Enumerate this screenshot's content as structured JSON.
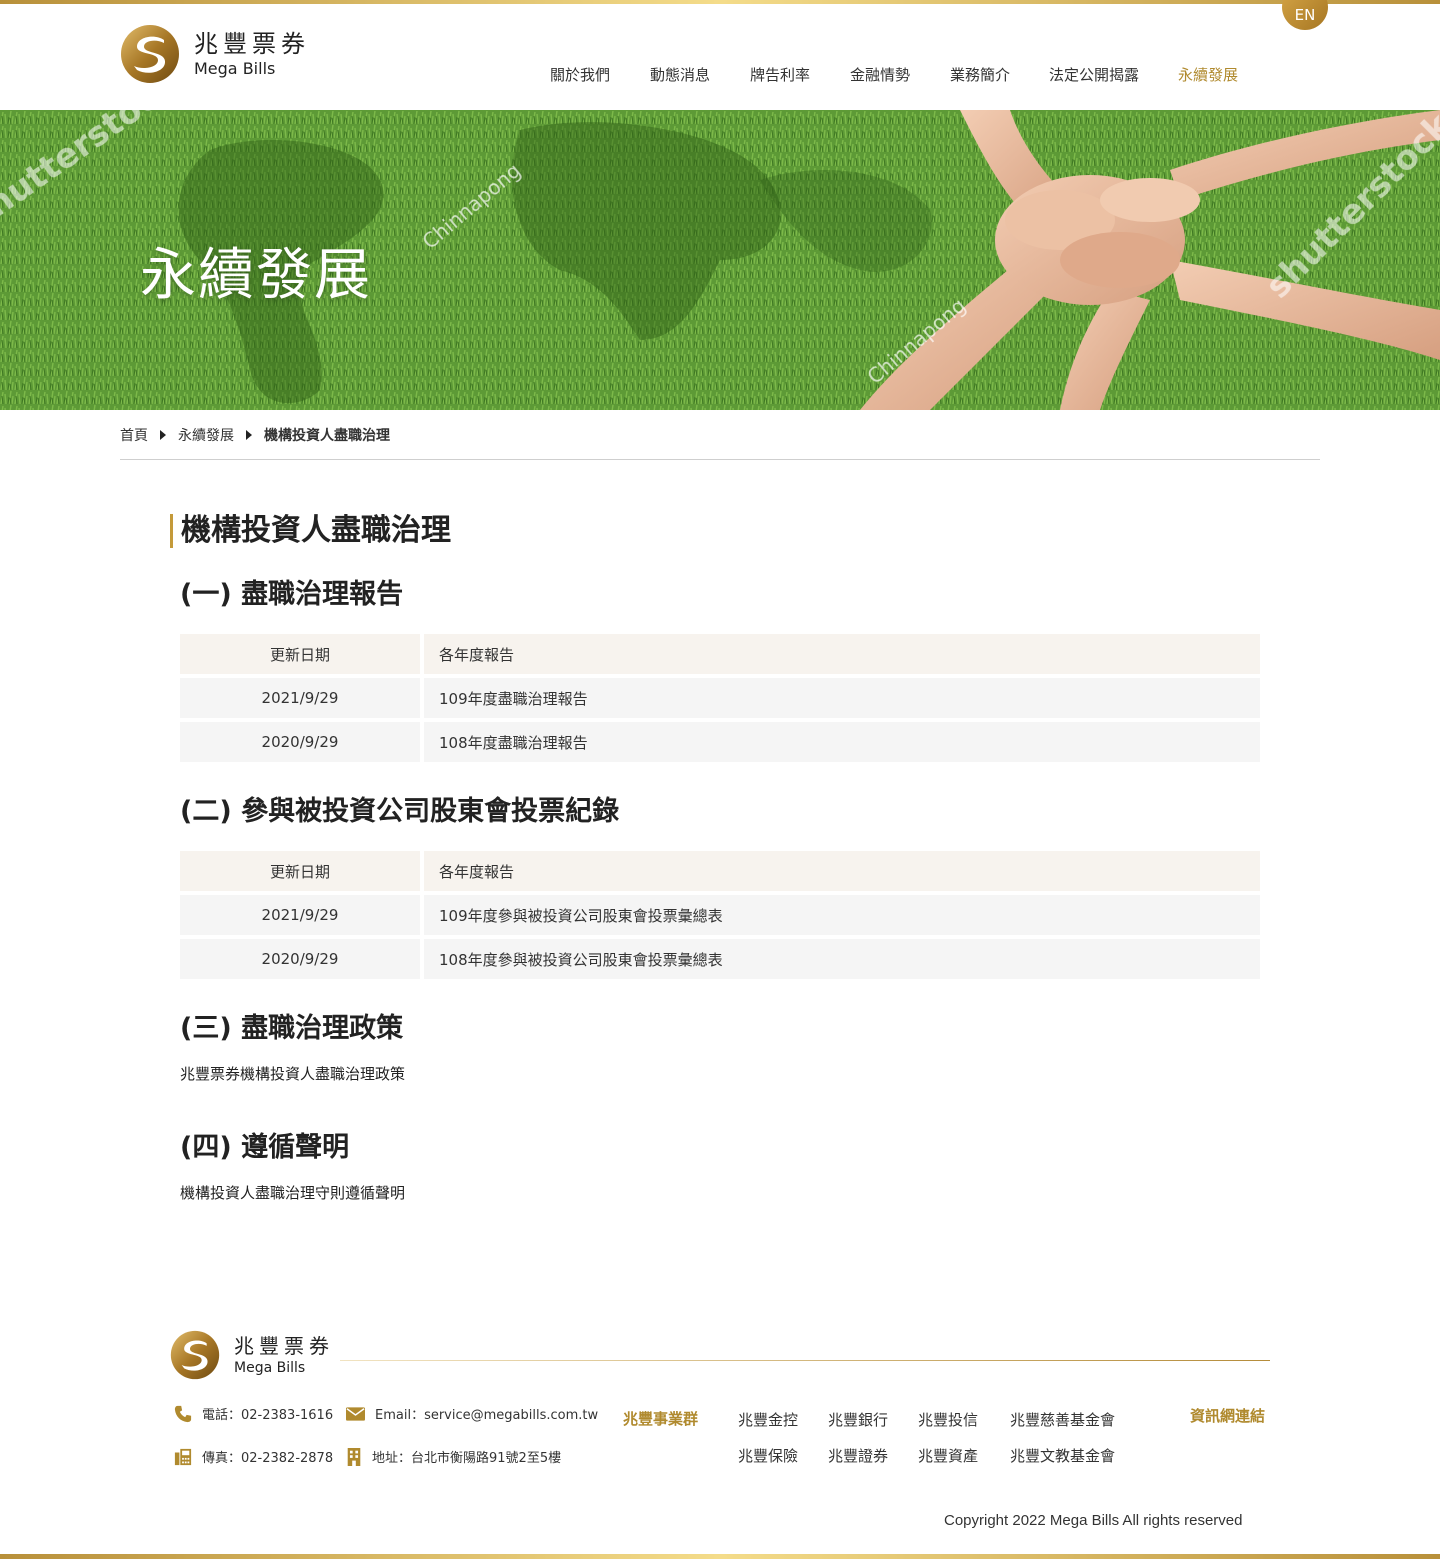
{
  "header": {
    "logo_cn": "兆豐票券",
    "logo_en": "Mega Bills",
    "lang_button": "EN",
    "nav": [
      {
        "label": "關於我們"
      },
      {
        "label": "動態消息"
      },
      {
        "label": "牌告利率"
      },
      {
        "label": "金融情勢"
      },
      {
        "label": "業務簡介"
      },
      {
        "label": "法定公開揭露"
      },
      {
        "label": "永續發展",
        "active": true
      }
    ]
  },
  "banner": {
    "title": "永續發展",
    "watermarks": [
      "shutterstock",
      "Chinnapong",
      "Chinnapong",
      "shutterstock"
    ]
  },
  "breadcrumb": [
    "首頁",
    "永續發展",
    "機構投資人盡職治理"
  ],
  "main": {
    "title": "機構投資人盡職治理",
    "sections": [
      {
        "title": "(一) 盡職治理報告",
        "header": {
          "date": "更新日期",
          "name": "各年度報告"
        },
        "rows": [
          {
            "date": "2021/9/29",
            "name": "109年度盡職治理報告"
          },
          {
            "date": "2020/9/29",
            "name": "108年度盡職治理報告"
          }
        ]
      },
      {
        "title": "(二) 參與被投資公司股東會投票紀錄",
        "header": {
          "date": "更新日期",
          "name": "各年度報告"
        },
        "rows": [
          {
            "date": "2021/9/29",
            "name": "109年度參與被投資公司股東會投票彙總表"
          },
          {
            "date": "2020/9/29",
            "name": "108年度參與被投資公司股東會投票彙總表"
          }
        ]
      },
      {
        "title": "(三) 盡職治理政策",
        "link": "兆豐票券機構投資人盡職治理政策"
      },
      {
        "title": "(四) 遵循聲明",
        "link": "機構投資人盡職治理守則遵循聲明"
      }
    ]
  },
  "footer": {
    "logo_cn": "兆豐票券",
    "logo_en": "Mega Bills",
    "phone": "電話：02-2383-1616",
    "fax": "傳真：02-2382-2878",
    "email": "Email：service@megabills.com.tw",
    "address": "地址：台北市衡陽路91號2至5樓",
    "group_title": "兆豐事業群",
    "group_links": [
      "兆豐金控",
      "兆豐銀行",
      "兆豐投信",
      "兆豐慈善基金會",
      "兆豐保險",
      "兆豐證券",
      "兆豐資產",
      "兆豐文教基金會"
    ],
    "info_title": "資訊網連結",
    "copyright": "Copyright 2022 Mega Bills All rights reserved"
  },
  "colors": {
    "accent_gold": "#b08a2e",
    "header_row_bg": "#f7f3ee",
    "body_row_bg": "#f5f5f5"
  }
}
